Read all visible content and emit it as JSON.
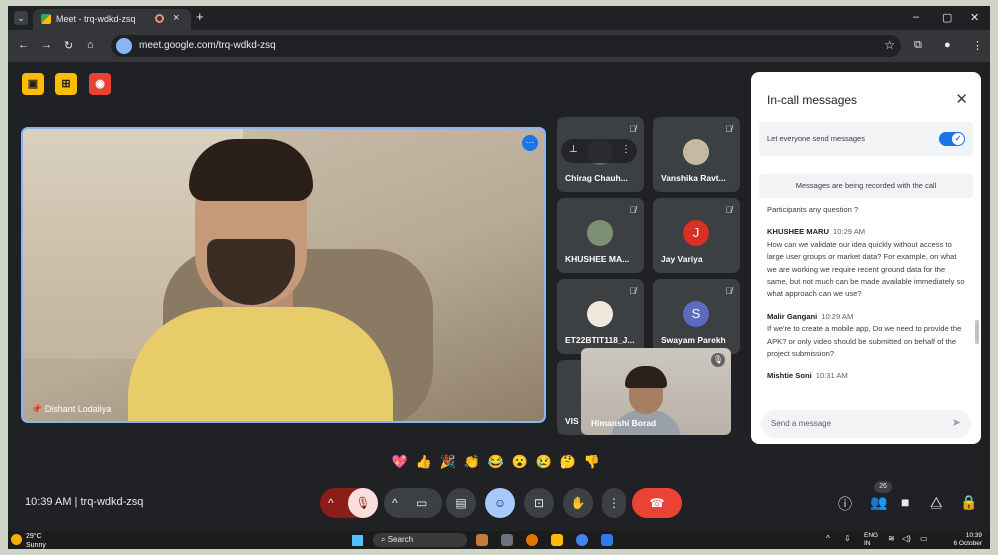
{
  "browser": {
    "tab_title": "Meet - trq-wdkd-zsq",
    "url": "meet.google.com/trq-wdkd-zsq"
  },
  "meeting": {
    "time": "10:39 AM",
    "code": "trq-wdkd-zsq",
    "speaker_name": "Dishant Lodaliya",
    "people_count": "26"
  },
  "participants": [
    {
      "name": "Chirag Chauh...",
      "avatar": "",
      "color": "#5f6368"
    },
    {
      "name": "Vanshika Ravt...",
      "avatar": "",
      "color": "#c8b9a6"
    },
    {
      "name": "KHUSHEE MA...",
      "avatar": "",
      "color": "#7d8f74"
    },
    {
      "name": "Jay Variya",
      "avatar": "J",
      "color": "#d93025"
    },
    {
      "name": "ET22BTIT118_J...",
      "avatar": "",
      "color": "#efe6dc"
    },
    {
      "name": "Swayam Parekh",
      "avatar": "S",
      "color": "#5c6bc0"
    },
    {
      "name": "VIS",
      "avatar": "",
      "color": "#3c4043"
    }
  ],
  "floating_tile": {
    "name": "Himanshi Borad"
  },
  "chat": {
    "title": "In-call messages",
    "allow_label": "Let everyone send messages",
    "recorded_note": "Messages are being recorded with the call",
    "first_line": "Participants any question ?",
    "messages": [
      {
        "sender": "KHUSHEE MARU",
        "time": "10:29 AM",
        "text": "How can we validate our idea quickly without access to large user groups or market data? For example, on what we are working we require recent ground data for the same, but not much can be made available immediately so what approach can we use?"
      },
      {
        "sender": "Malir Gangani",
        "time": "10:29 AM",
        "text": "If we're to create a mobile app, Do we need to provide the APK? or only video should be submitted on behalf of the project submission?"
      },
      {
        "sender": "Mishtie Soni",
        "time": "10:31 AM",
        "text": ""
      }
    ],
    "input_placeholder": "Send a message"
  },
  "reactions": [
    "💖",
    "👍",
    "🎉",
    "👏",
    "😂",
    "😮",
    "😢",
    "🤔",
    "👎"
  ],
  "taskbar": {
    "temperature": "29°C",
    "weather": "Sunny",
    "search": "Search",
    "lang_top": "ENG",
    "lang_bottom": "IN",
    "clock_time": "10:39",
    "clock_date": "6 October"
  },
  "colors": {
    "accent": "#1a73e8",
    "end_call": "#ea4335",
    "mic_off": "#f9dedc"
  }
}
